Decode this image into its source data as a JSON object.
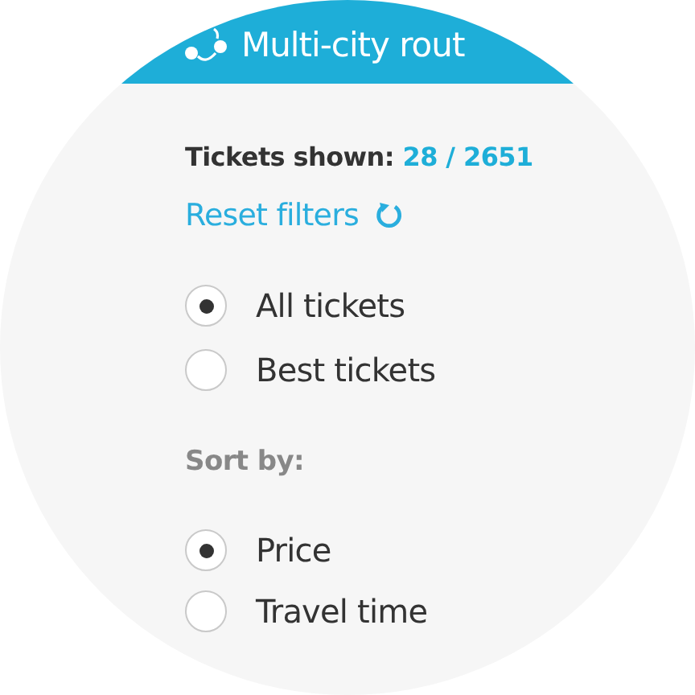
{
  "header": {
    "title": "Multi-city rout"
  },
  "summary": {
    "label": "Tickets shown:",
    "count": "28 / 2651"
  },
  "reset": {
    "label": "Reset filters"
  },
  "ticket_filter": [
    {
      "label": "All tickets",
      "selected": true
    },
    {
      "label": "Best tickets",
      "selected": false
    }
  ],
  "sort": {
    "title": "Sort by:",
    "options": [
      {
        "label": "Price",
        "selected": true
      },
      {
        "label": "Travel time",
        "selected": false
      }
    ]
  }
}
